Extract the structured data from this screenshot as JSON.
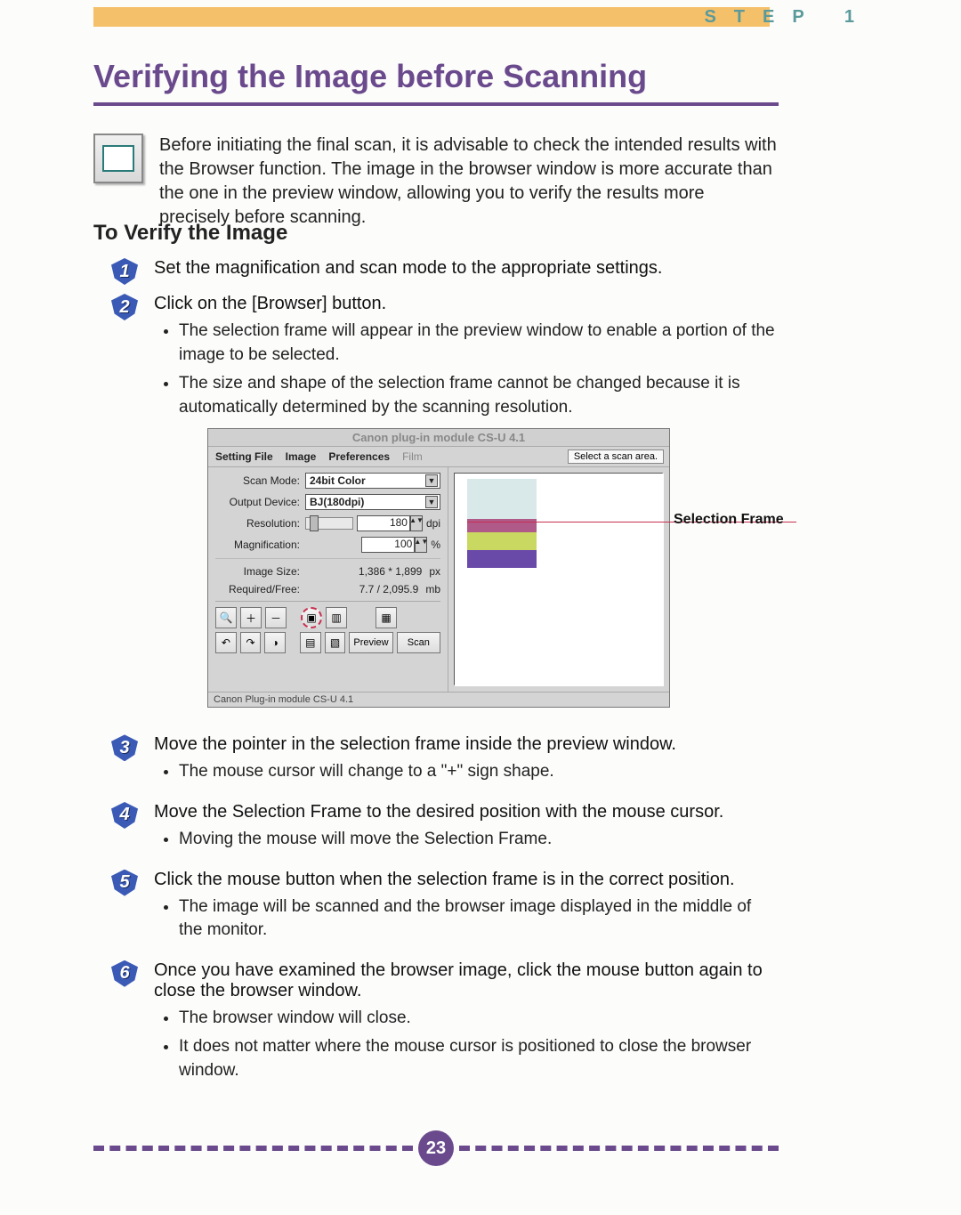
{
  "header": {
    "step_label": "STEP 1"
  },
  "title": "Verifying the Image before Scanning",
  "intro": "Before initiating the final scan, it is advisable to check the intended results with the Browser function. The image in the browser window is more accurate than the one in the preview window, allowing you to verify the results more precisely before scanning.",
  "sub_heading": "To Verify the Image",
  "steps": [
    {
      "n": "1",
      "title": "Set the magnification and scan mode to the appropriate settings.",
      "bullets": []
    },
    {
      "n": "2",
      "title": "Click on the [Browser] button.",
      "bullets": [
        "The selection frame will appear in the preview window to enable a portion of the image to be selected.",
        "The size and shape of the selection frame cannot be changed because it is automatically determined by the scanning resolution."
      ]
    },
    {
      "n": "3",
      "title": "Move the pointer in the selection frame inside the preview window.",
      "bullets": [
        "The mouse cursor will change to a \"+\" sign shape."
      ]
    },
    {
      "n": "4",
      "title": "Move the Selection Frame to the desired position with the mouse cursor.",
      "bullets": [
        "Moving the mouse will move the Selection Frame."
      ]
    },
    {
      "n": "5",
      "title": "Click the mouse button when the selection frame is in the correct position.",
      "bullets": [
        "The image will be scanned and the browser image displayed in the middle of the monitor."
      ]
    },
    {
      "n": "6",
      "title": "Once you have examined the browser image, click the mouse button again to close the browser window.",
      "bullets": [
        "The browser window will close.",
        "It does not matter where the mouse cursor is positioned to close the browser window."
      ]
    }
  ],
  "app": {
    "title": "Canon plug-in module CS-U 4.1",
    "menu": [
      "Setting File",
      "Image",
      "Preferences",
      "Film"
    ],
    "hint": "Select a scan area.",
    "labels": {
      "scan_mode": "Scan Mode:",
      "output_device": "Output Device:",
      "resolution": "Resolution:",
      "magnification": "Magnification:",
      "image_size": "Image Size:",
      "required_free": "Required/Free:"
    },
    "values": {
      "scan_mode": "24bit Color",
      "output_device": "BJ(180dpi)",
      "resolution": "180",
      "resolution_unit": "dpi",
      "magnification": "100",
      "magnification_unit": "%",
      "image_size": "1,386 * 1,899",
      "image_size_unit": "px",
      "required_free": "7.7 / 2,095.9",
      "required_free_unit": "mb"
    },
    "buttons": {
      "preview": "Preview",
      "scan": "Scan"
    },
    "status": "Canon Plug-in module CS-U 4.1"
  },
  "callout": {
    "selection_frame": "Selection Frame"
  },
  "page_number": "23"
}
